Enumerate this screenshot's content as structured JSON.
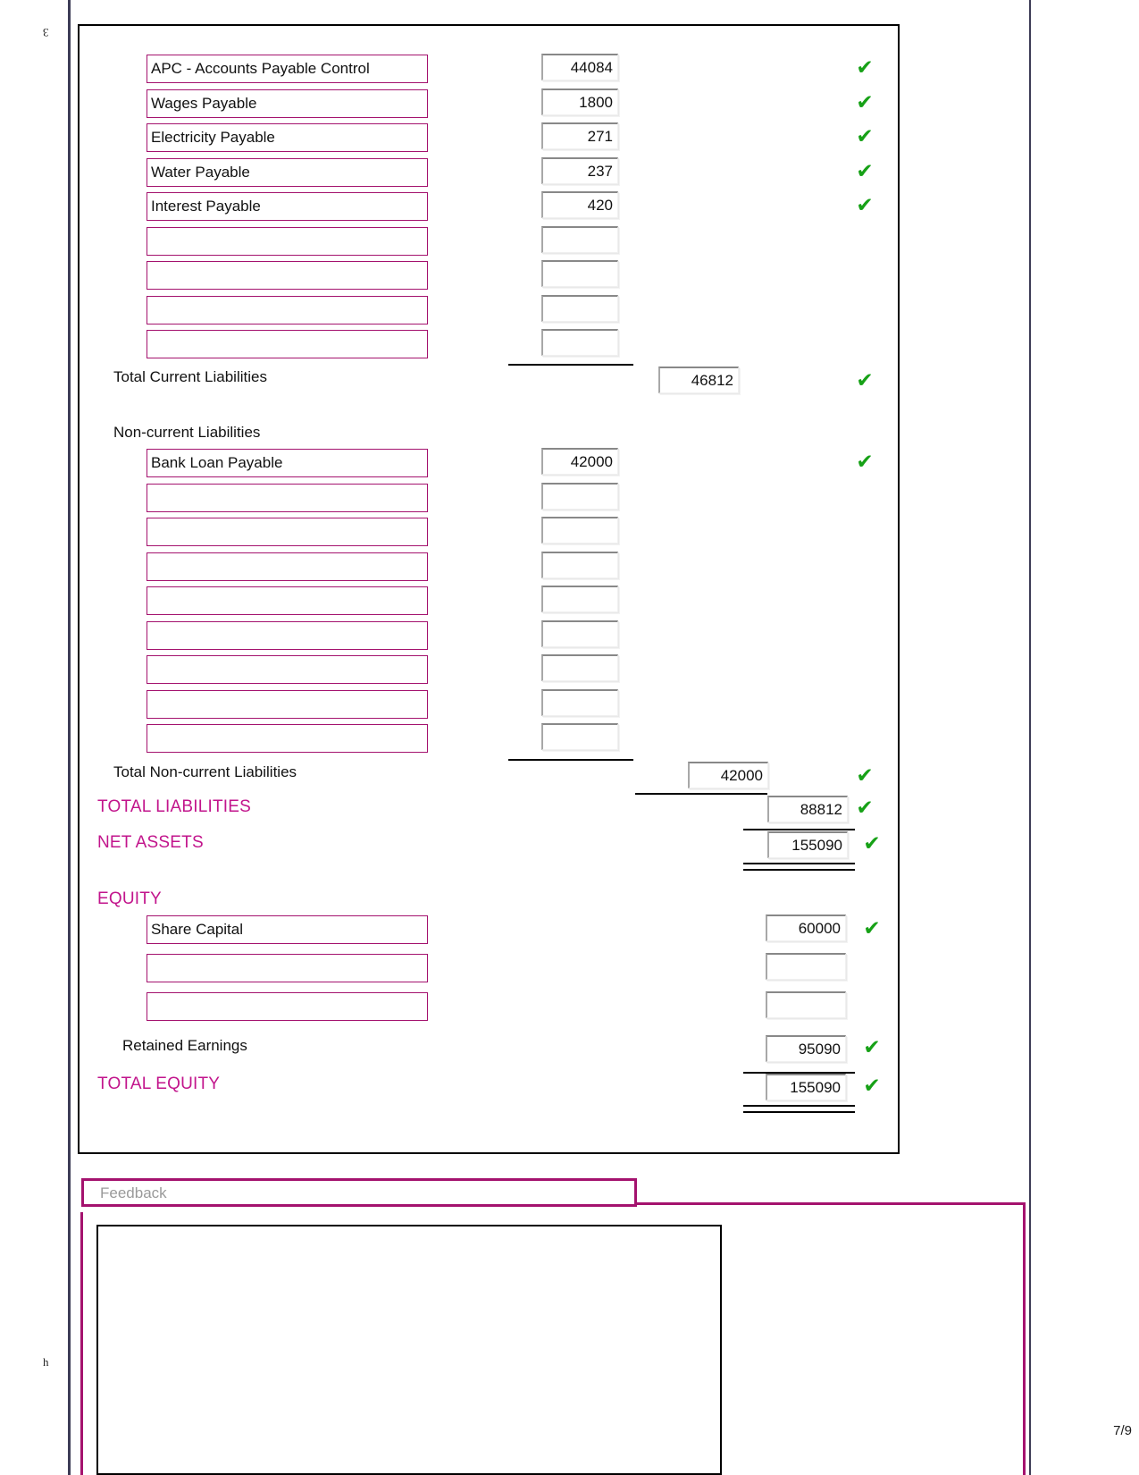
{
  "page": {
    "number_label": "7/9",
    "margin_glyph_top": "3",
    "margin_glyph_bottom": "ɥ"
  },
  "colors": {
    "magenta": "#c2158c",
    "border_magenta": "#a4126e",
    "tick_green": "#17a117",
    "frame_navy": "#3d3c56"
  },
  "icons": {
    "tick": "✔"
  },
  "worksheet": {
    "current_liabilities": {
      "rows": [
        {
          "name": "APC - Accounts Payable Control",
          "value": "44084",
          "checked": true
        },
        {
          "name": "Wages Payable",
          "value": "1800",
          "checked": true
        },
        {
          "name": "Electricity Payable",
          "value": "271",
          "checked": true
        },
        {
          "name": "Water Payable",
          "value": "237",
          "checked": true
        },
        {
          "name": "Interest Payable",
          "value": "420",
          "checked": true
        },
        {
          "name": "",
          "value": "",
          "checked": false
        },
        {
          "name": "",
          "value": "",
          "checked": false
        },
        {
          "name": "",
          "value": "",
          "checked": false
        },
        {
          "name": "",
          "value": "",
          "checked": false
        }
      ],
      "total_label": "Total Current Liabilities",
      "total_value": "46812",
      "total_checked": true
    },
    "noncurrent_liabilities": {
      "heading": "Non-current Liabilities",
      "rows": [
        {
          "name": "Bank Loan Payable",
          "value": "42000",
          "checked": true
        },
        {
          "name": "",
          "value": "",
          "checked": false
        },
        {
          "name": "",
          "value": "",
          "checked": false
        },
        {
          "name": "",
          "value": "",
          "checked": false
        },
        {
          "name": "",
          "value": "",
          "checked": false
        },
        {
          "name": "",
          "value": "",
          "checked": false
        },
        {
          "name": "",
          "value": "",
          "checked": false
        },
        {
          "name": "",
          "value": "",
          "checked": false
        },
        {
          "name": "",
          "value": "",
          "checked": false
        }
      ],
      "total_label": "Total Non-current Liabilities",
      "total_value": "42000",
      "total_checked": true
    },
    "total_liabilities": {
      "label": "TOTAL LIABILITIES",
      "value": "88812",
      "checked": true
    },
    "net_assets": {
      "label": "NET ASSETS",
      "value": "155090",
      "checked": true
    },
    "equity": {
      "heading": "EQUITY",
      "rows": [
        {
          "name": "Share Capital",
          "value": "60000",
          "checked": true
        },
        {
          "name": "",
          "value": "",
          "checked": false
        },
        {
          "name": "",
          "value": "",
          "checked": false
        }
      ],
      "retained_earnings_label": "Retained Earnings",
      "retained_earnings_value": "95090",
      "retained_earnings_checked": true,
      "total_label": "TOTAL EQUITY",
      "total_value": "155090",
      "total_checked": true
    }
  },
  "feedback": {
    "label": "Feedback",
    "text": ""
  }
}
